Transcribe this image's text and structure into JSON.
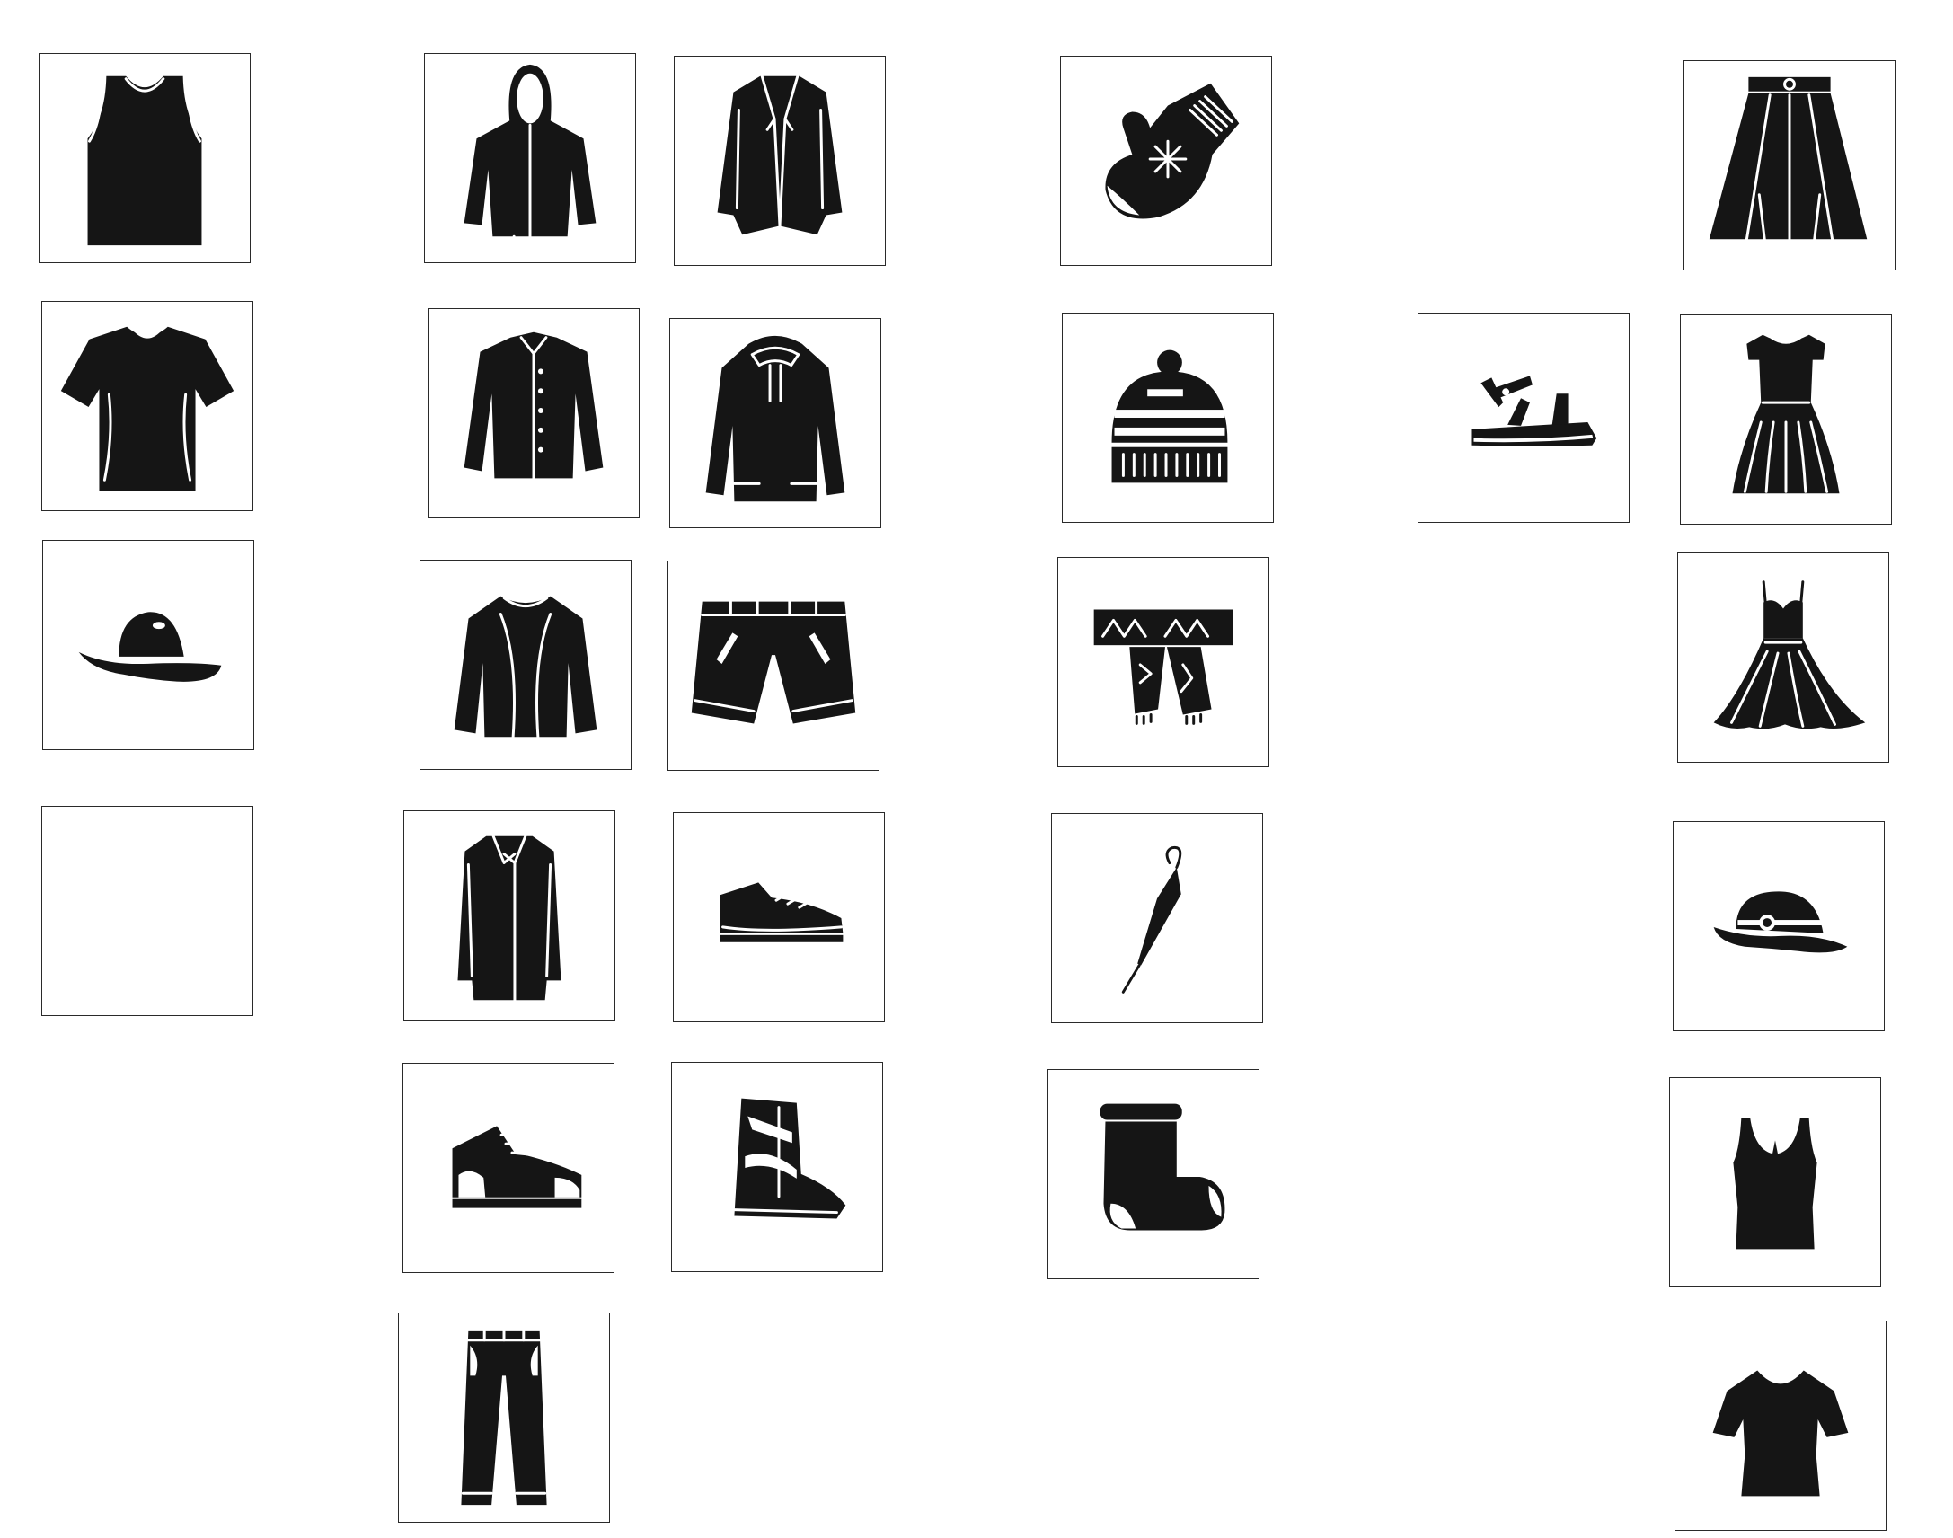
{
  "palette": {
    "ink": "#151515",
    "frame": "#2a2a2a",
    "background": "#ffffff"
  },
  "tiles": [
    {
      "icon": "tank-top-icon"
    },
    {
      "icon": "t-shirt-icon"
    },
    {
      "icon": "cowboy-hat-icon"
    },
    {
      "icon": "empty-tile"
    },
    {
      "icon": "hooded-jacket-icon"
    },
    {
      "icon": "button-shirt-icon"
    },
    {
      "icon": "sweater-icon"
    },
    {
      "icon": "long-coat-icon"
    },
    {
      "icon": "high-top-sneaker-icon"
    },
    {
      "icon": "jeans-icon"
    },
    {
      "icon": "blazer-icon"
    },
    {
      "icon": "hoodie-sweatshirt-icon"
    },
    {
      "icon": "shorts-icon"
    },
    {
      "icon": "running-shoe-icon"
    },
    {
      "icon": "snowboard-boot-icon"
    },
    {
      "icon": "mitten-icon"
    },
    {
      "icon": "beanie-hat-icon"
    },
    {
      "icon": "scarf-icon"
    },
    {
      "icon": "umbrella-icon"
    },
    {
      "icon": "sock-icon"
    },
    {
      "icon": "sandal-icon"
    },
    {
      "icon": "skirt-icon"
    },
    {
      "icon": "short-sleeve-dress-icon"
    },
    {
      "icon": "evening-dress-icon"
    },
    {
      "icon": "fedora-hat-icon"
    },
    {
      "icon": "women-tank-top-icon"
    },
    {
      "icon": "women-t-shirt-icon"
    }
  ]
}
